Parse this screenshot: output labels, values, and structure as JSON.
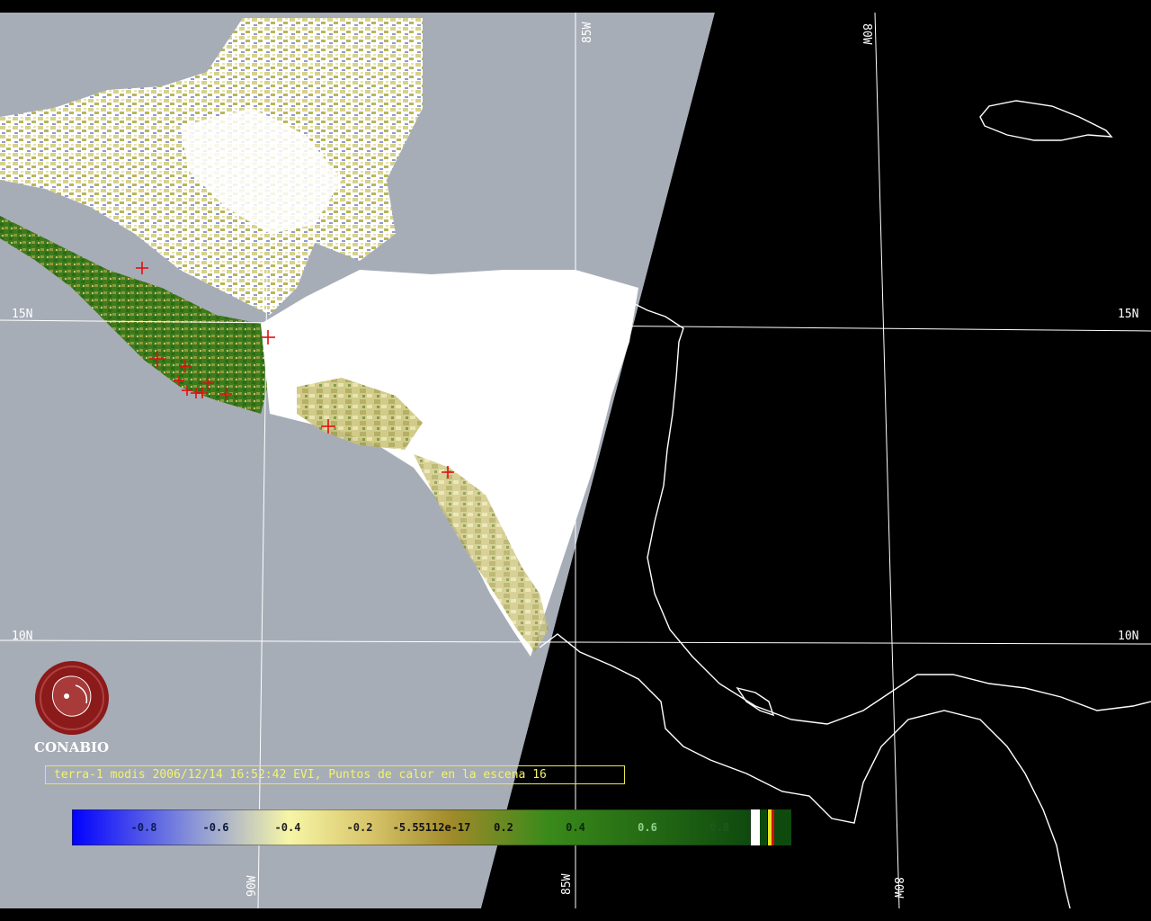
{
  "map": {
    "grid_labels": {
      "lat_15": "15N",
      "lat_10": "10N",
      "lon_85": "85W",
      "lon_80": "80W",
      "lon_90": "90W"
    },
    "hotspot_count": 16,
    "colors": {
      "background_gray": "#a7adb7",
      "night_side": "#000000",
      "cloud": "#ffffff",
      "coastline": "#ffffff",
      "gridline": "#ffffff",
      "hotspot": "#e01010"
    }
  },
  "logo": {
    "name": "CONABIO",
    "color": "#8b1a1a"
  },
  "caption": {
    "text": "terra-1 modis 2006/12/14 16:52:42 EVI, Puntos de calor en la escena 16"
  },
  "colorbar": {
    "tick_labels": [
      "-0.8",
      "-0.6",
      "-0.4",
      "-0.2",
      "-5.55112e-17",
      "0.2",
      "0.4",
      "0.6",
      "0.8"
    ],
    "colors": [
      "#0000ff",
      "#8a95d8",
      "#f6f6a6",
      "#d8c46a",
      "#8a9a2a",
      "#2a7a12",
      "#0e4a0e"
    ]
  }
}
